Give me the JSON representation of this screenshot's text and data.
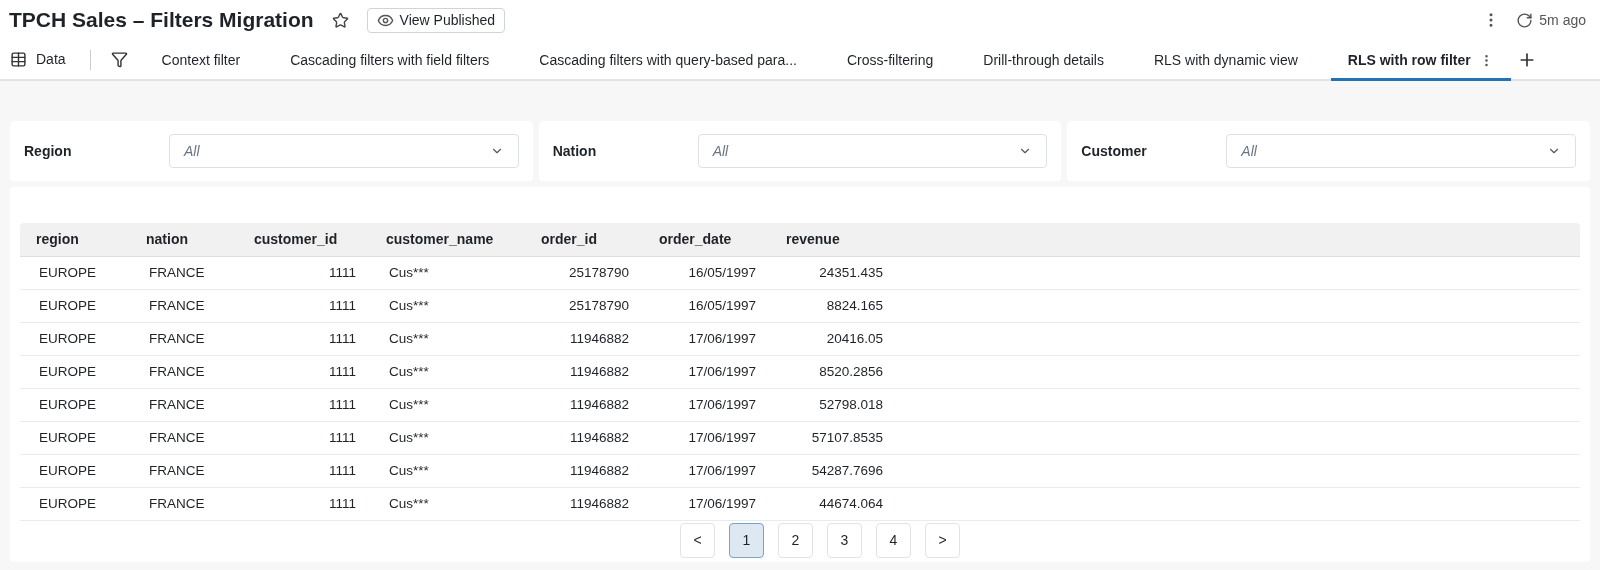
{
  "header": {
    "title": "TPCH Sales – Filters Migration",
    "view_button": "View Published",
    "refreshed": "5m ago"
  },
  "toolbar": {
    "data_label": "Data"
  },
  "tabs": [
    {
      "label": "Context filter",
      "selected": false
    },
    {
      "label": "Cascading filters with field filters",
      "selected": false
    },
    {
      "label": "Cascading filters with query-based para...",
      "selected": false
    },
    {
      "label": "Cross-filtering",
      "selected": false
    },
    {
      "label": "Drill-through details",
      "selected": false
    },
    {
      "label": "RLS with dynamic view",
      "selected": false
    },
    {
      "label": "RLS with row filter",
      "selected": true
    }
  ],
  "filters": [
    {
      "label": "Region",
      "value": "All"
    },
    {
      "label": "Nation",
      "value": "All"
    },
    {
      "label": "Customer",
      "value": "All"
    }
  ],
  "table": {
    "columns": [
      {
        "label": "region",
        "kind": "text"
      },
      {
        "label": "nation",
        "kind": "text"
      },
      {
        "label": "customer_id",
        "kind": "number"
      },
      {
        "label": "customer_name",
        "kind": "text"
      },
      {
        "label": "order_id",
        "kind": "number"
      },
      {
        "label": "order_date",
        "kind": "number"
      },
      {
        "label": "revenue",
        "kind": "number"
      }
    ],
    "rows": [
      [
        "EUROPE",
        "FRANCE",
        "1111",
        "Cus***",
        "25178790",
        "16/05/1997",
        "24351.435"
      ],
      [
        "EUROPE",
        "FRANCE",
        "1111",
        "Cus***",
        "25178790",
        "16/05/1997",
        "8824.165"
      ],
      [
        "EUROPE",
        "FRANCE",
        "1111",
        "Cus***",
        "11946882",
        "17/06/1997",
        "20416.05"
      ],
      [
        "EUROPE",
        "FRANCE",
        "1111",
        "Cus***",
        "11946882",
        "17/06/1997",
        "8520.2856"
      ],
      [
        "EUROPE",
        "FRANCE",
        "1111",
        "Cus***",
        "11946882",
        "17/06/1997",
        "52798.018"
      ],
      [
        "EUROPE",
        "FRANCE",
        "1111",
        "Cus***",
        "11946882",
        "17/06/1997",
        "57107.8535"
      ],
      [
        "EUROPE",
        "FRANCE",
        "1111",
        "Cus***",
        "11946882",
        "17/06/1997",
        "54287.7696"
      ],
      [
        "EUROPE",
        "FRANCE",
        "1111",
        "Cus***",
        "11946882",
        "17/06/1997",
        "44674.064"
      ]
    ]
  },
  "pagination": {
    "previous": "<",
    "next": ">",
    "pages": [
      {
        "label": "1",
        "selected": true
      },
      {
        "label": "2",
        "selected": false
      },
      {
        "label": "3",
        "selected": false
      },
      {
        "label": "4",
        "selected": false
      }
    ]
  }
}
